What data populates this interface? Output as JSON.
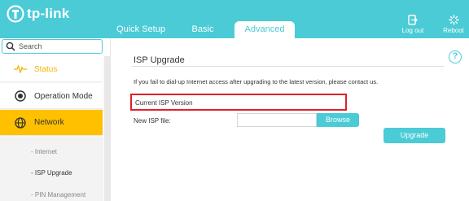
{
  "brand": {
    "name": "tp-link",
    "header_color": "#4acbd6",
    "accent_color": "#ffc000"
  },
  "tabs": [
    {
      "label": "Quick Setup",
      "active": false
    },
    {
      "label": "Basic",
      "active": false
    },
    {
      "label": "Advanced",
      "active": true
    }
  ],
  "header_buttons": {
    "logout": {
      "label": "Log out",
      "icon": "logout-icon"
    },
    "reboot": {
      "label": "Reboot",
      "icon": "reboot-icon"
    }
  },
  "sidebar": {
    "search_placeholder": "Search",
    "items": [
      {
        "label": "Status",
        "icon": "pulse-icon"
      },
      {
        "label": "Operation Mode",
        "icon": "toggle-icon"
      },
      {
        "label": "Network",
        "icon": "globe-icon",
        "active": true
      }
    ],
    "subitems": [
      {
        "label": "- Internet"
      },
      {
        "label": "- ISP Upgrade",
        "active": true
      },
      {
        "label": "- PIN Management"
      }
    ]
  },
  "main": {
    "title": "ISP Upgrade",
    "notice": "If you fail to dial-up Internet access after upgrading to the latest version, please contact us.",
    "current_label": "Current ISP Version",
    "new_file_label": "New ISP file:",
    "file_value": "",
    "browse_label": "Browse",
    "upgrade_label": "Upgrade",
    "help_glyph": "?",
    "highlight_color": "#e0202a"
  }
}
